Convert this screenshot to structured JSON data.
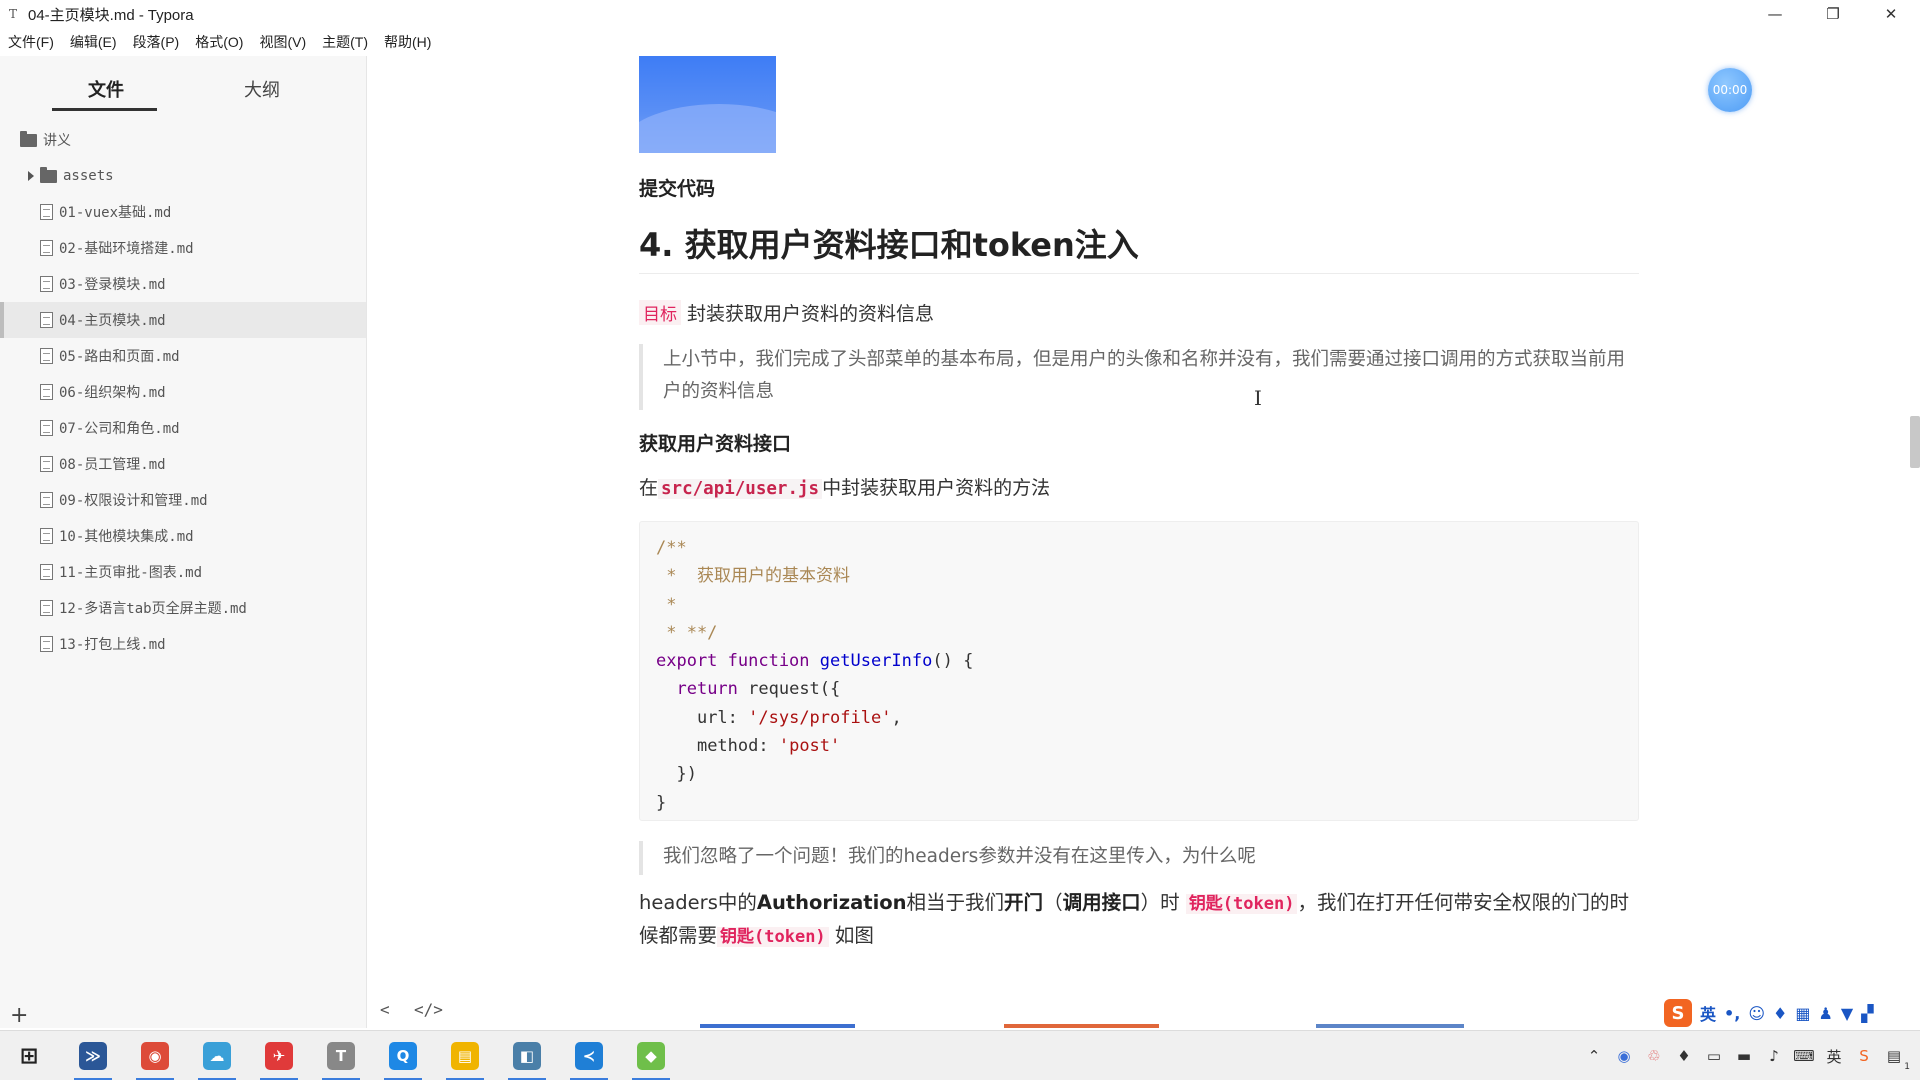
{
  "window": {
    "app_icon": "T",
    "title": "04-主页模块.md - Typora",
    "controls": [
      "—",
      "❐",
      "✕"
    ]
  },
  "menu": [
    "文件(F)",
    "编辑(E)",
    "段落(P)",
    "格式(O)",
    "视图(V)",
    "主题(T)",
    "帮助(H)"
  ],
  "sidebar": {
    "tab_files": "文件",
    "tab_outline": "大纲",
    "root_folder": "讲义",
    "assets_folder": "assets",
    "files": [
      "01-vuex基础.md",
      "02-基础环境搭建.md",
      "03-登录模块.md",
      "04-主页模块.md",
      "05-路由和页面.md",
      "06-组织架构.md",
      "07-公司和角色.md",
      "08-员工管理.md",
      "09-权限设计和管理.md",
      "10-其他模块集成.md",
      "11-主页审批-图表.md",
      "12-多语言tab页全屏主题.md",
      "13-打包上线.md"
    ],
    "active_index": 3,
    "add_button": "+"
  },
  "editor": {
    "timer": "00:00",
    "commit_heading": "提交代码",
    "h2": "4. 获取用户资料接口和token注入",
    "goal_tag": "目标",
    "goal_text": "封装获取用户资料的资料信息",
    "quote1": "上小节中，我们完成了头部菜单的基本布局，但是用户的头像和名称并没有，我们需要通过接口调用的方式获取当前用户的资料信息",
    "h4": "获取用户资料接口",
    "api_prefix": "在",
    "api_path": "src/api/user.js",
    "api_suffix": "中封装获取用户资料的方法",
    "code": {
      "c1": "/**",
      "c2": " *  获取用户的基本资料",
      "c3": " *",
      "c4": " * **/",
      "l5_kw": "export function",
      "l5_fn": "getUserInfo",
      "l5_rest": "() {",
      "l6_kw": "return",
      "l6_rest": " request({",
      "l7_key": "url: ",
      "l7_str": "'/sys/profile'",
      "l7_end": ",",
      "l8_key": "method: ",
      "l8_str": "'post'",
      "l9": "  })",
      "l10": "}"
    },
    "quote2": "我们忽略了一个问题！我们的headers参数并没有在这里传入，为什么呢",
    "headers_p": {
      "t1": "headers中的",
      "b1": "Authorization",
      "t2": "相当于我们",
      "b2": "开门",
      "t3": "（",
      "b3": "调用接口",
      "t4": "）时",
      "r1": "钥匙(token)",
      "t5": "，我们在打开任何带安全权限的门的时候都需要",
      "r2": "钥匙(token)",
      "t6": "如图"
    },
    "nav_prev": "<",
    "nav_source": "</>"
  },
  "ime": {
    "logo": "S",
    "lang": "英"
  },
  "colors": {
    "accent_red": "#e0245e",
    "hero_blue": "#3d7cf5",
    "timer_blue": "#4e9cf5"
  },
  "taskbar": {
    "apps": [
      {
        "name": "powershell-icon",
        "glyph": "≫",
        "color": "#2b5797"
      },
      {
        "name": "chrome-icon",
        "glyph": "◉",
        "color": "#dd4b39"
      },
      {
        "name": "cloud-app-icon",
        "glyph": "☁",
        "color": "#3aa0d8"
      },
      {
        "name": "dingtalk-icon",
        "glyph": "✈",
        "color": "#e03a3a"
      },
      {
        "name": "typora-icon",
        "glyph": "T",
        "color": "#888888"
      },
      {
        "name": "search-app-icon",
        "glyph": "Q",
        "color": "#1e88e5"
      },
      {
        "name": "file-explorer-icon",
        "glyph": "▤",
        "color": "#f0b400"
      },
      {
        "name": "notes-app-icon",
        "glyph": "◧",
        "color": "#4a7fa8"
      },
      {
        "name": "vscode-icon",
        "glyph": "≺",
        "color": "#1f7fd6"
      },
      {
        "name": "game-app-icon",
        "glyph": "◆",
        "color": "#6fbf4a"
      }
    ],
    "notifications_badge": "1"
  }
}
